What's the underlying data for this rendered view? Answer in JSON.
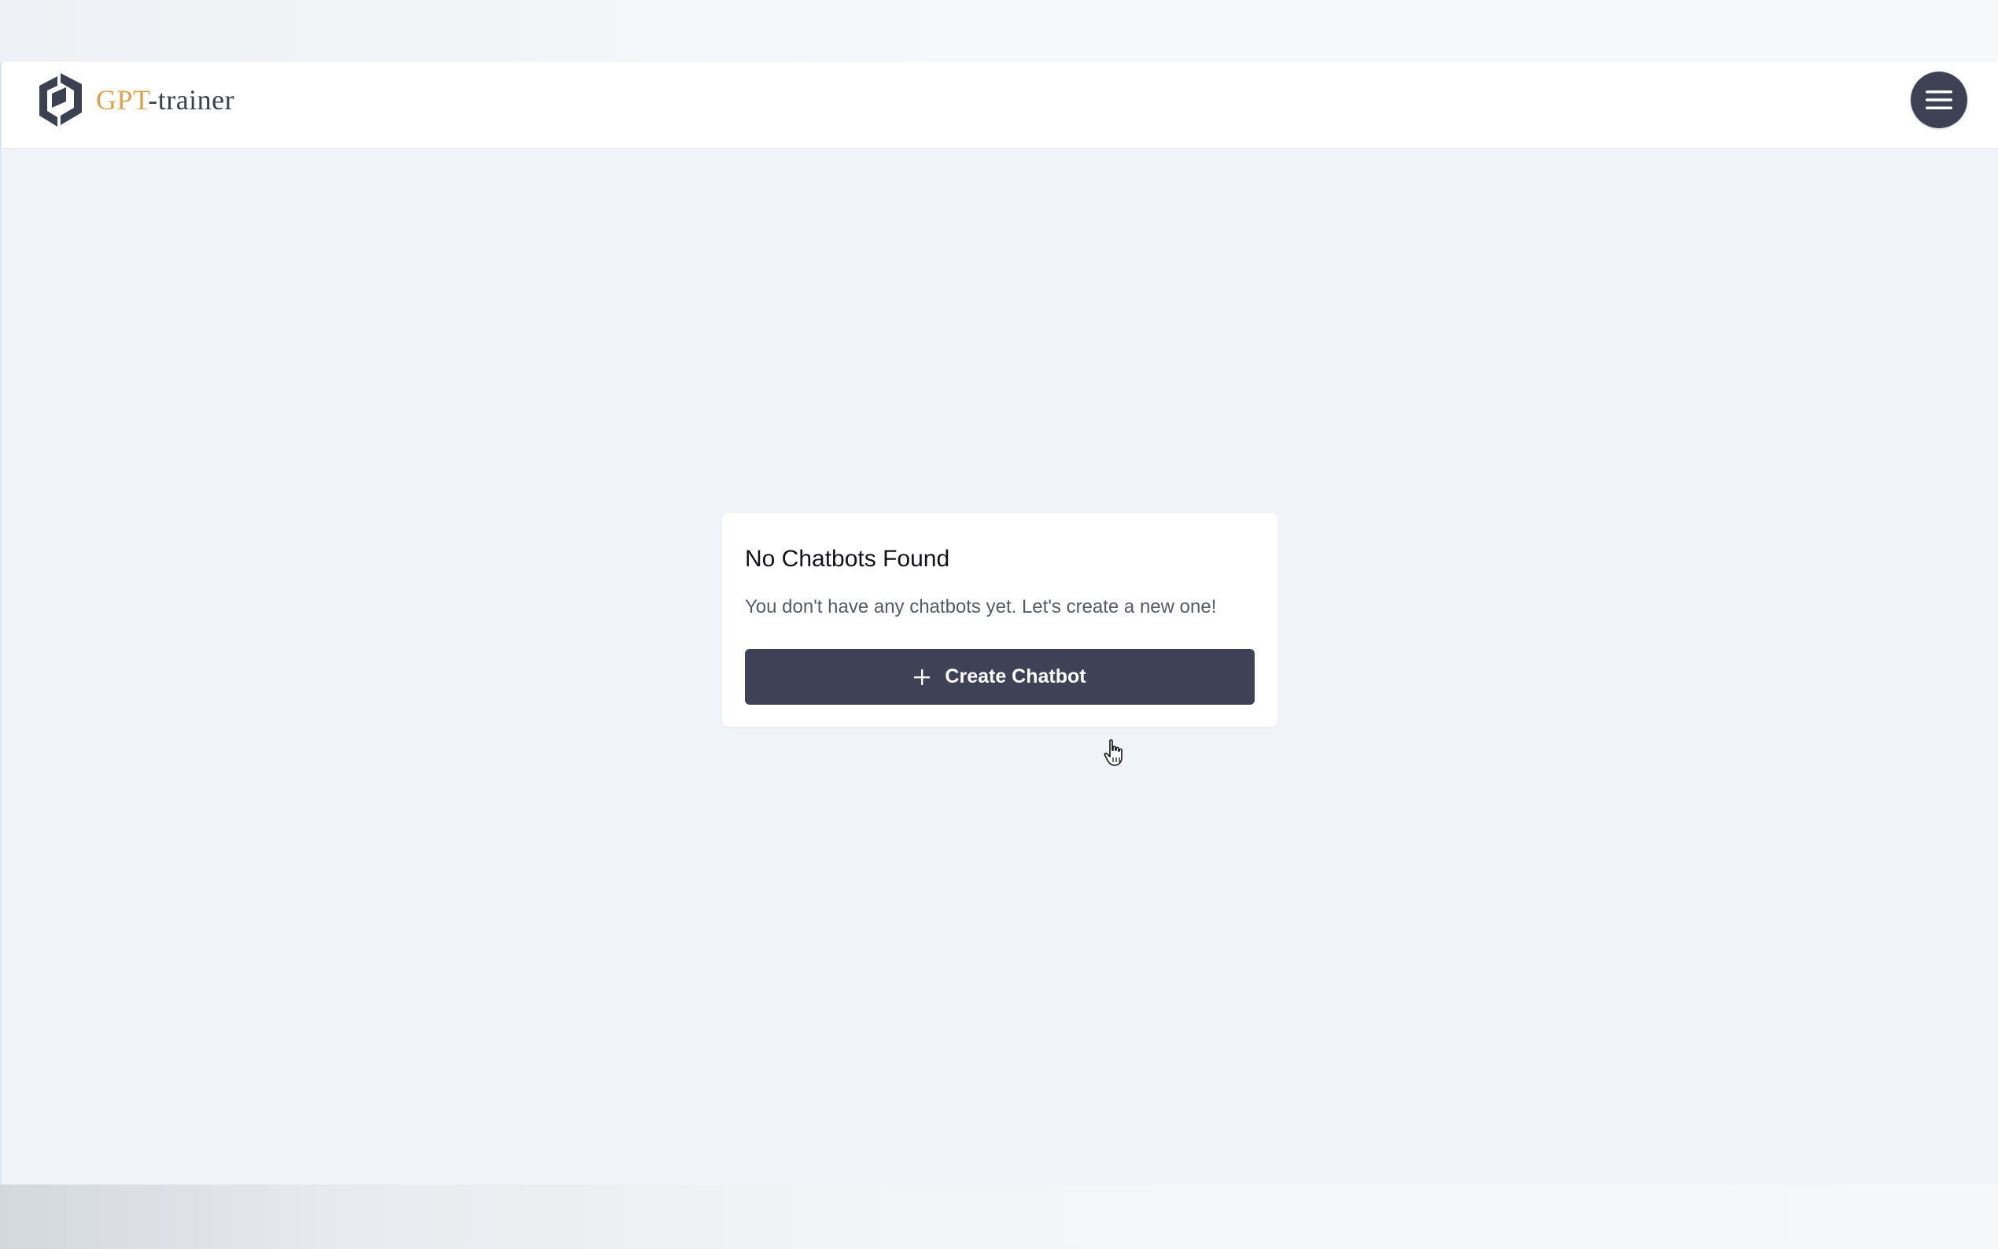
{
  "app": {
    "logo_part1": "GPT",
    "logo_part2": "-trainer",
    "menu_icon": "hamburger-icon"
  },
  "empty_state": {
    "title": "No Chatbots Found",
    "message": "You don't have any chatbots yet. Let's create a new one!",
    "create_button_label": "Create Chatbot",
    "create_button_icon": "plus-icon"
  },
  "colors": {
    "accent_gold": "#e3a24a",
    "brand_dark": "#3d4153",
    "page_background": "#f0f4f8",
    "card_background": "#ffffff"
  }
}
